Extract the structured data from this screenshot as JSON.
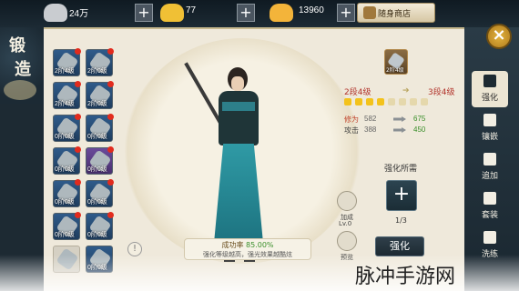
{
  "currencies": [
    {
      "name": "silver-icon",
      "value": "24万",
      "color": "#c9ccd0"
    },
    {
      "name": "gold-ingot-icon",
      "value": "77",
      "color": "#f0c035"
    },
    {
      "name": "gold-bar-icon",
      "value": "13960",
      "color": "#f3b43a"
    }
  ],
  "shop": {
    "label": "随身商店"
  },
  "title": {
    "line1": "锻",
    "line2": "造"
  },
  "grid": [
    {
      "level": "2阶4级",
      "dot": true,
      "color": "blue"
    },
    {
      "level": "2阶0级",
      "dot": true,
      "color": "blue"
    },
    {
      "level": "2阶4级",
      "dot": true,
      "color": "blue"
    },
    {
      "level": "2阶0级",
      "dot": true,
      "color": "blue"
    },
    {
      "level": "0阶0级",
      "dot": true,
      "color": "blue"
    },
    {
      "level": "0阶0级",
      "dot": true,
      "color": "blue"
    },
    {
      "level": "0阶0级",
      "dot": true,
      "color": "blue"
    },
    {
      "level": "0阶0级",
      "dot": true,
      "color": "purple"
    },
    {
      "level": "0阶0级",
      "dot": true,
      "color": "blue"
    },
    {
      "level": "0阶0级",
      "dot": true,
      "color": "blue"
    },
    {
      "level": "0阶0级",
      "dot": true,
      "color": "blue"
    },
    {
      "level": "0阶0级",
      "dot": true,
      "color": "blue"
    },
    {
      "level": "",
      "dot": false,
      "color": "empty"
    },
    {
      "level": "0阶0级",
      "dot": false,
      "color": "blue"
    }
  ],
  "selected_item": {
    "level": "2阶4级"
  },
  "stage": {
    "from": "2段4级",
    "to": "3段4级",
    "filled": 4,
    "total": 8
  },
  "stats": [
    {
      "label": "修为",
      "from": "582",
      "to": "675"
    },
    {
      "label": "攻击",
      "from": "388",
      "to": "450"
    }
  ],
  "requirement": {
    "title": "强化所需",
    "count": "1/3"
  },
  "side_actions": [
    {
      "label": "加成",
      "sub": "Lv.0"
    },
    {
      "label": "预览",
      "sub": ""
    }
  ],
  "upgrade_button": "强化",
  "success": {
    "prefix": "成功率",
    "rate": "85.00%",
    "note": "强化等级越高，强光效果越酷炫"
  },
  "info_icon": "!",
  "tabs": [
    "强化",
    "镶嵌",
    "追加",
    "套装",
    "洗练"
  ],
  "active_tab": 0,
  "close": "×",
  "watermark": "脉冲手游网"
}
